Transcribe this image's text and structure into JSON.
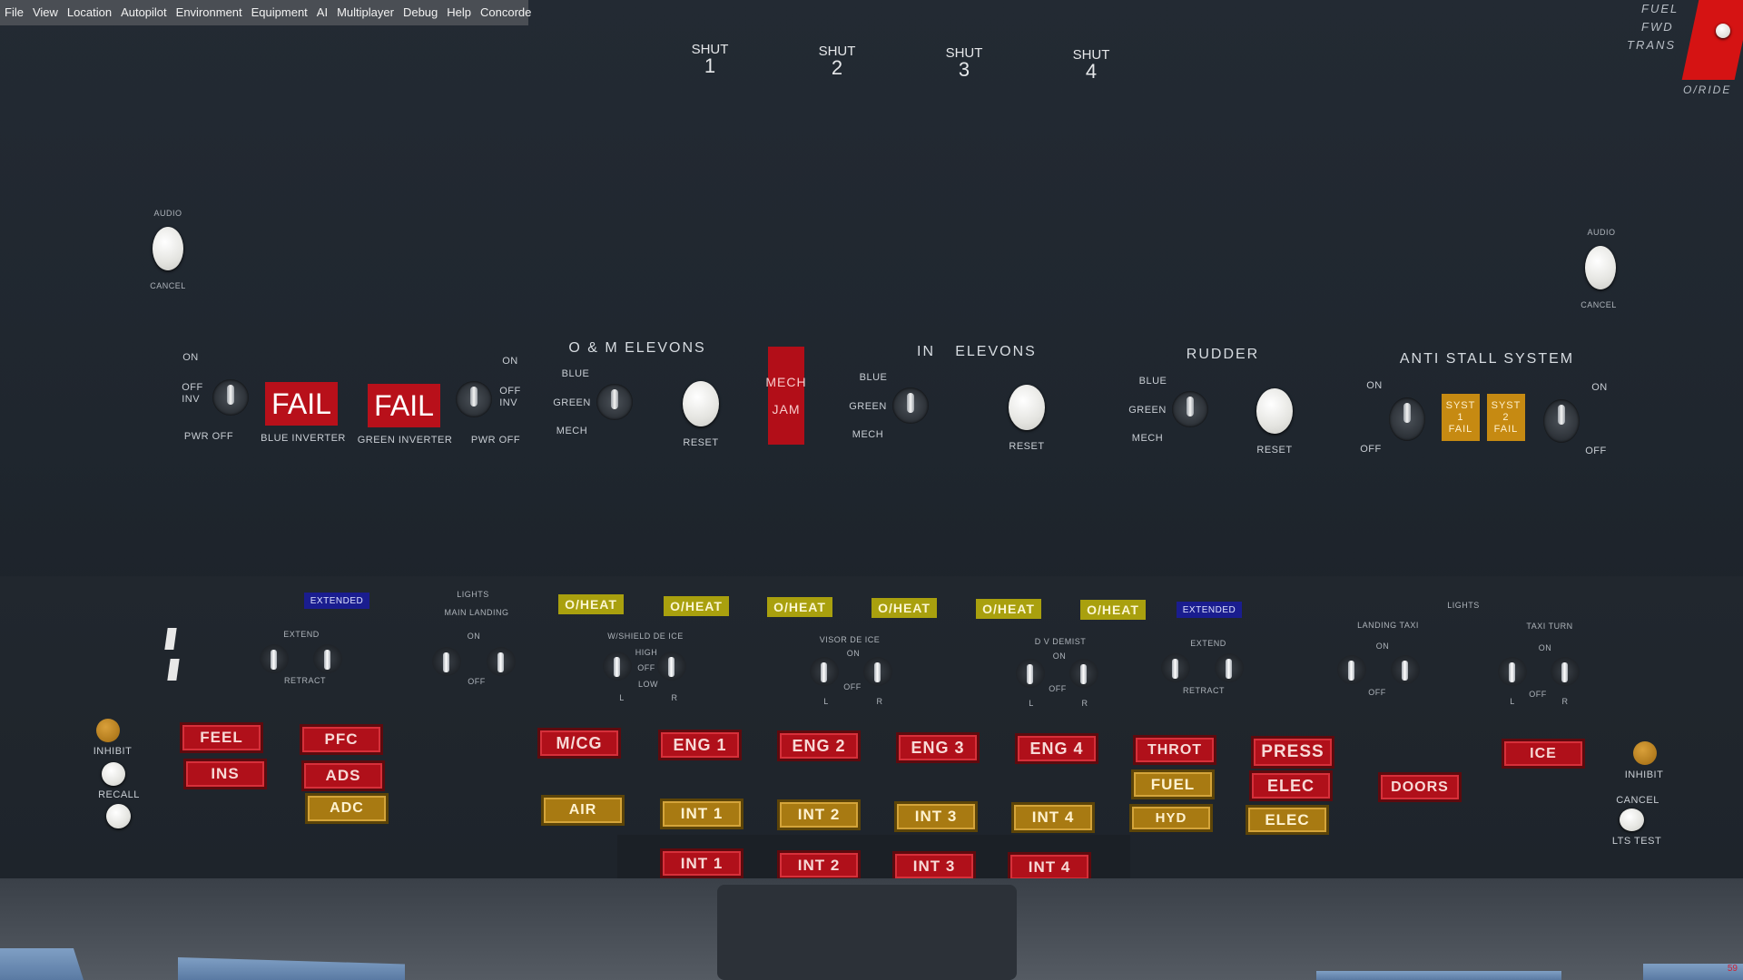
{
  "menu": [
    "File",
    "View",
    "Location",
    "Autopilot",
    "Environment",
    "Equipment",
    "AI",
    "Multiplayer",
    "Debug",
    "Help",
    "Concorde"
  ],
  "shut": [
    {
      "label": "SHUT",
      "num": "1"
    },
    {
      "label": "SHUT",
      "num": "2"
    },
    {
      "label": "SHUT",
      "num": "3"
    },
    {
      "label": "SHUT",
      "num": "4"
    }
  ],
  "fuel": {
    "l1": "FUEL",
    "l2": "FWD",
    "l3": "TRANS",
    "override": "O/RIDE"
  },
  "audio": {
    "left_top": "AUDIO",
    "left_bottom": "CANCEL",
    "right_top": "AUDIO",
    "right_bottom": "CANCEL"
  },
  "inverters": {
    "on_l": "ON",
    "off_inv_l": "OFF\nINV",
    "pwr_off_l": "PWR OFF",
    "fail1": "FAIL",
    "blue_inverter": "BLUE INVERTER",
    "fail2": "FAIL",
    "green_inverter": "GREEN INVERTER",
    "on_r": "ON",
    "off_inv_r": "OFF\nINV",
    "pwr_off_r": "PWR OFF"
  },
  "om_elevons": {
    "title": "O & M ELEVONS",
    "blue": "BLUE",
    "green": "GREEN",
    "mech": "MECH",
    "reset": "RESET",
    "mech_jam1": "MECH",
    "mech_jam2": "JAM"
  },
  "in_elevons": {
    "title_in": "IN",
    "title": "ELEVONS",
    "blue": "BLUE",
    "green": "GREEN",
    "mech": "MECH",
    "reset": "RESET"
  },
  "rudder": {
    "title": "RUDDER",
    "blue": "BLUE",
    "green": "GREEN",
    "mech": "MECH",
    "reset": "RESET"
  },
  "anti_stall": {
    "title": "ANTI STALL SYSTEM",
    "on_l": "ON",
    "off_l": "OFF",
    "syst1": "SYST\n1\nFAIL",
    "syst2": "SYST\n2\nFAIL",
    "on_r": "ON",
    "off_r": "OFF"
  },
  "lower": {
    "extended_l": "EXTENDED",
    "extend_l": "EXTEND",
    "retract_l": "RETRACT",
    "lights_l": "LIGHTS",
    "main_landing": "MAIN LANDING",
    "on_ml": "ON",
    "off_ml": "OFF",
    "oheat": [
      "O/HEAT",
      "O/HEAT",
      "O/HEAT",
      "O/HEAT",
      "O/HEAT",
      "O/HEAT"
    ],
    "wshield": "W/SHIELD DE ICE",
    "high": "HIGH",
    "off_ws": "OFF",
    "low": "LOW",
    "l_ws": "L",
    "r_ws": "R",
    "visor": "VISOR DE ICE",
    "on_v": "ON",
    "off_v": "OFF",
    "l_v": "L",
    "r_v": "R",
    "dv": "D V DEMIST",
    "on_dv": "ON",
    "off_dv": "OFF",
    "l_dv": "L",
    "r_dv": "R",
    "extended_r": "EXTENDED",
    "extend_r": "EXTEND",
    "retract_r": "RETRACT",
    "landing_taxi": "LANDING TAXI",
    "on_lt": "ON",
    "off_lt": "OFF",
    "lights_r": "LIGHTS",
    "taxi_turn": "TAXI TURN",
    "on_tt": "ON",
    "off_tt": "OFF",
    "l_tt": "L",
    "r_tt": "R"
  },
  "warnings": {
    "inhibit_l": "INHIBIT",
    "recall": "RECALL",
    "feel": "FEEL",
    "ins": "INS",
    "pfc": "PFC",
    "ads": "ADS",
    "adc": "ADC",
    "mcg": "M/CG",
    "air": "AIR",
    "eng": [
      "ENG 1",
      "ENG 2",
      "ENG 3",
      "ENG 4"
    ],
    "int_amber": [
      "INT 1",
      "INT 2",
      "INT 3",
      "INT 4"
    ],
    "int_red": [
      "INT 1",
      "INT 2",
      "INT 3",
      "INT 4"
    ],
    "throt": "THROT",
    "fuel": "FUEL",
    "hyd": "HYD",
    "press": "PRESS",
    "elec_red": "ELEC",
    "elec_amber": "ELEC",
    "doors": "DOORS",
    "ice": "ICE",
    "inhibit_r": "INHIBIT",
    "cancel": "CANCEL",
    "lts_test": "LTS TEST"
  },
  "fps": "59",
  "colors": {
    "red_annunciator": "#b0101a",
    "amber_annunciator": "#a87a12",
    "yellow_oheat": "#a9a00e",
    "blue_extended": "#1a1d8f",
    "override": "#d51313"
  }
}
